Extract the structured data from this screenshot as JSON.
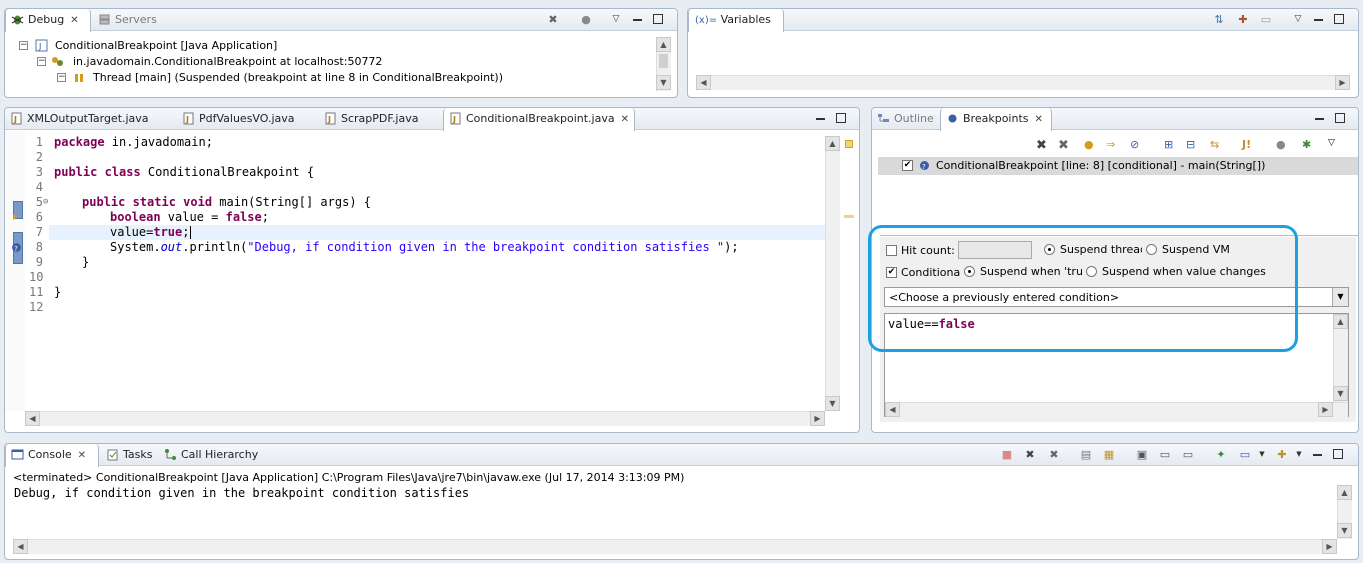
{
  "debug_view": {
    "tabs": [
      {
        "label": "Debug",
        "icon": "bug-icon"
      },
      {
        "label": "Servers",
        "icon": "servers-icon"
      }
    ],
    "tree": [
      {
        "label": "ConditionalBreakpoint [Java Application]",
        "icon": "java-app-icon",
        "expander": "−"
      },
      {
        "label": "in.javadomain.ConditionalBreakpoint at localhost:50772",
        "icon": "debug-target-icon",
        "expander": "−"
      },
      {
        "label": "Thread [main] (Suspended (breakpoint at line 8 in ConditionalBreakpoint))",
        "icon": "thread-suspended-icon",
        "expander": "−"
      }
    ]
  },
  "variables_view": {
    "tab_label": "Variables",
    "tab_icon_text": "(x)="
  },
  "editor": {
    "tabs": [
      {
        "label": "XMLOutputTarget.java",
        "icon": "java-file-icon"
      },
      {
        "label": "PdfValuesVO.java",
        "icon": "java-file-icon"
      },
      {
        "label": "ScrapPDF.java",
        "icon": "java-file-icon"
      },
      {
        "label": "ConditionalBreakpoint.java",
        "icon": "java-file-icon"
      }
    ],
    "line_numbers": [
      "1",
      "2",
      "3",
      "4",
      "5",
      "6",
      "7",
      "8",
      "9",
      "10",
      "11",
      "12"
    ],
    "line5_marker": "⊖",
    "code": {
      "l1_kw": "package",
      "l1_rest": " in.javadomain;",
      "l3_kw": "public class",
      "l3_rest": " ConditionalBreakpoint {",
      "l5_kw": "public static void",
      "l5_rest": " main(String[] args) {",
      "l6_kw": "boolean",
      "l6_mid": " value = ",
      "l6_kw2": "false",
      "l6_end": ";",
      "l7_pre": "value=",
      "l7_kw": "true",
      "l7_end": ";",
      "l8_pre": "System.",
      "l8_ital": "out",
      "l8_mid": ".println(",
      "l8_str": "\"Debug, if condition given in the breakpoint condition satisfies \"",
      "l8_end": ");",
      "l9": "}",
      "l11": "}"
    }
  },
  "breakpoints_view": {
    "tabs": [
      {
        "label": "Outline",
        "icon": "outline-icon"
      },
      {
        "label": "Breakpoints",
        "icon": "breakpoints-icon"
      }
    ],
    "items": [
      {
        "label": "ConditionalBreakpoint [line: 8] [conditional] - main(String[])",
        "checked": true
      }
    ],
    "details": {
      "hit_count_label": "Hit count:",
      "hit_count_value": "",
      "suspend_thread_label": "Suspend thread",
      "suspend_vm_label": "Suspend VM",
      "conditional_label": "Conditional",
      "suspend_true_label": "Suspend when 'true'",
      "suspend_changes_label": "Suspend when value changes",
      "condition_history_placeholder": "<Choose a previously entered condition>",
      "condition_pre": "value==",
      "condition_kw": "false"
    },
    "highlight_color": "#1ba1e2"
  },
  "console_view": {
    "tabs": [
      {
        "label": "Console",
        "icon": "console-icon"
      },
      {
        "label": "Tasks",
        "icon": "tasks-icon"
      },
      {
        "label": "Call Hierarchy",
        "icon": "call-hierarchy-icon"
      }
    ],
    "status": "<terminated> ConditionalBreakpoint [Java Application] C:\\Program Files\\Java\\jre7\\bin\\javaw.exe (Jul 17, 2014 3:13:09 PM)",
    "output": "Debug, if condition given in the breakpoint condition satisfies"
  }
}
